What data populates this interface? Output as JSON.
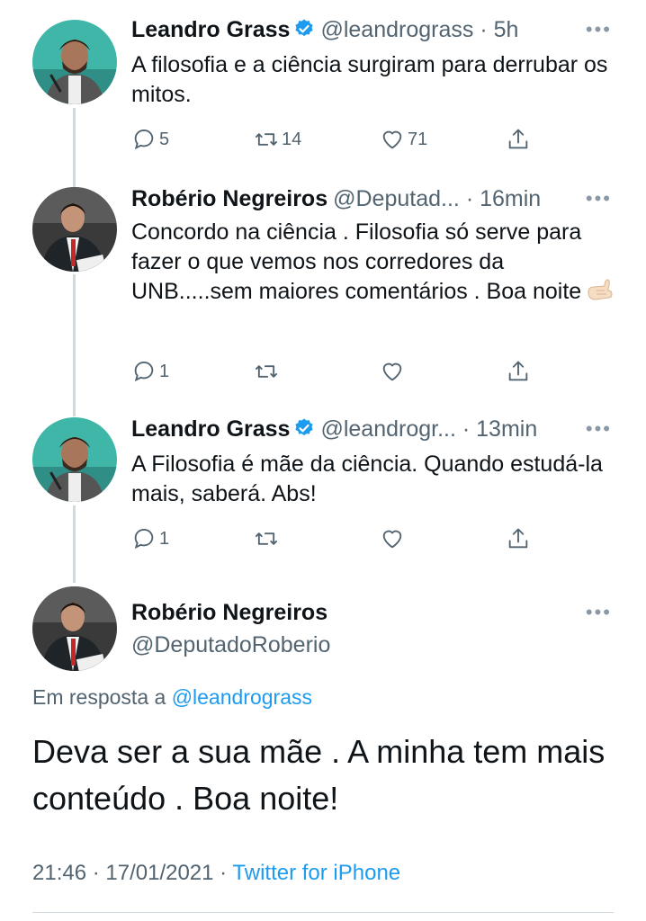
{
  "tweets": [
    {
      "name": "Leandro Grass",
      "verified": true,
      "handle": "@leandrograss",
      "time": "· 5h",
      "text": "A filosofia e a ciência surgiram para derrubar os mitos.",
      "replies": "5",
      "retweets": "14",
      "likes": "71"
    },
    {
      "name": "Robério Negreiros",
      "verified": false,
      "handle": "@Deputad...",
      "time": "· 16min",
      "text": "Concordo na ciência . Filosofia  só serve para fazer o que vemos nos corredores da UNB.....sem maiores comentários . Boa noite",
      "emoji": "call-me-hand-emoji",
      "replies": "1",
      "retweets": "",
      "likes": ""
    },
    {
      "name": "Leandro Grass",
      "verified": true,
      "handle": "@leandrogr...",
      "time": "· 13min",
      "text": "A Filosofia é mãe da ciência. Quando estudá-la mais, saberá. Abs!",
      "replies": "1",
      "retweets": "",
      "likes": ""
    }
  ],
  "main_tweet": {
    "name": "Robério Negreiros",
    "handle": "@DeputadoRoberio",
    "reply_prefix": "Em resposta a",
    "reply_handle": "@leandrograss",
    "text": "Deva ser a sua mãe . A minha tem mais conteúdo . Boa noite!",
    "time": "21:46 · 17/01/2021 ·",
    "source": "Twitter for iPhone"
  },
  "colors": {
    "accent": "#1d9bf0",
    "secondary_text": "#536471",
    "thread_line": "#cfd9de",
    "avatar_leandro_bg": "#3fb6a8",
    "avatar_roberio_bg": "#3a3a3a"
  },
  "icons": [
    "reply-icon",
    "retweet-icon",
    "like-icon",
    "share-icon",
    "more-icon",
    "verified-badge-icon"
  ]
}
